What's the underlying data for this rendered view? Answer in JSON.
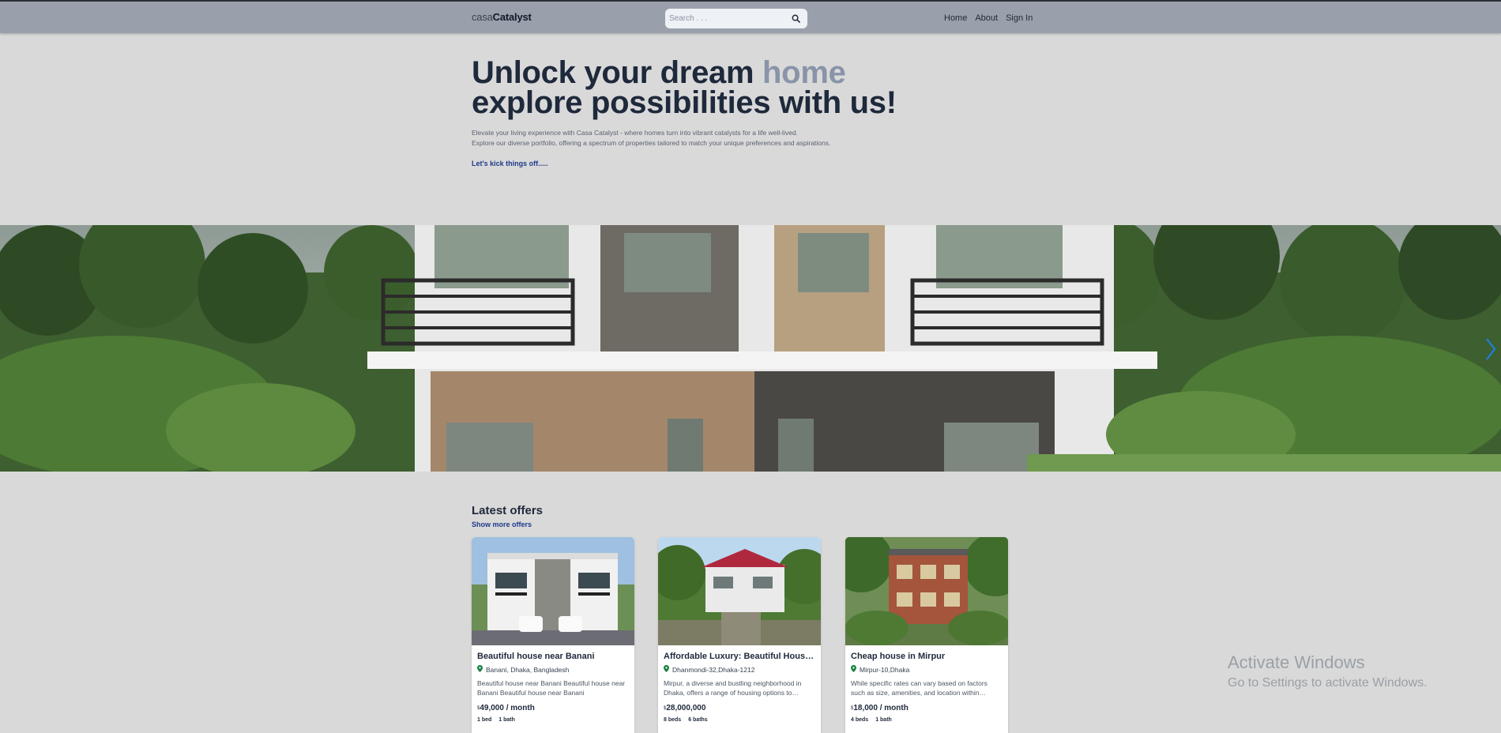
{
  "header": {
    "logo_part1": "casa",
    "logo_part2": "Catalyst",
    "search_placeholder": "Search . . .",
    "nav": [
      "Home",
      "About",
      "Sign In"
    ]
  },
  "hero": {
    "title_part1": "Unlock your dream ",
    "title_accent": "home",
    "title_line2": "explore possibilities with us!",
    "subtitle_line1": "Elevate your living experience with Casa Catalyst - where homes turn into vibrant catalysts for a life well-lived.",
    "subtitle_line2": "Explore our diverse portfolio, offering a spectrum of properties tailored to match your unique preferences and aspirations.",
    "cta": "Let's kick things off....."
  },
  "banner": {
    "image": "house-facade-photo",
    "next_icon": "chevron-right-icon"
  },
  "offers": {
    "title": "Latest offers",
    "more_link": "Show more offers",
    "cards": [
      {
        "title": "Beautiful house near Banani",
        "location": "Banani, Dhaka, Bangladesh",
        "description": "Beautiful house near Banani Beautiful house near Banani Beautiful house near Banani",
        "currency": "$",
        "price": "49,000 / month",
        "beds": "1 bed",
        "baths": "1 bath"
      },
      {
        "title": "Affordable Luxury: Beautiful House in Dhanmondi",
        "location": "Dhanmondi-32,Dhaka-1212",
        "description": "Mirpur, a diverse and bustling neighborhood in Dhaka, offers a range of housing options to…",
        "currency": "$",
        "price": "28,000,000",
        "beds": "8 beds",
        "baths": "6 baths"
      },
      {
        "title": "Cheap house in Mirpur",
        "location": "Mirpur-10,Dhaka",
        "description": "While specific rates can vary based on factors such as size, amenities, and location within…",
        "currency": "$",
        "price": "18,000 / month",
        "beds": "4 beds",
        "baths": "1 bath"
      }
    ]
  },
  "watermark": {
    "line1": "Activate Windows",
    "line2": "Go to Settings to activate Windows."
  },
  "colors": {
    "background": "#d9d9d9",
    "header": "#9aa0ab",
    "title": "#1e293b",
    "accent": "#8994a8",
    "link": "#1e3a8a",
    "location_pin": "#15803d"
  }
}
